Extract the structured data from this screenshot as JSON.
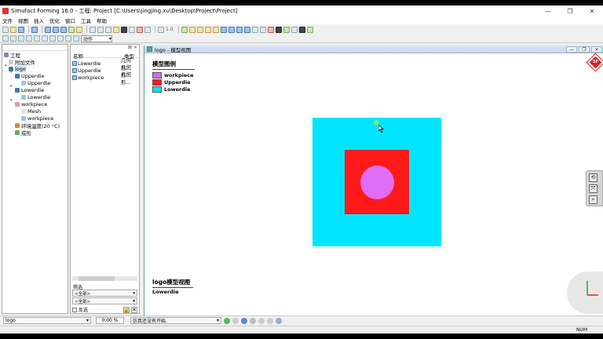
{
  "window": {
    "title": "Simufact Forming 16.0 - 工程: Project [C:\\Users\\jingjing.xu\\Desktop\\Project\\Project]",
    "minimize": "—",
    "maximize": "❐",
    "close": "✕"
  },
  "menu": [
    "文件",
    "视图",
    "插入",
    "优化",
    "窗口",
    "工具",
    "帮助"
  ],
  "toolbar": {
    "zoom_value": "1.0",
    "action_combo": "动作"
  },
  "tree": {
    "items": [
      {
        "label": "工程"
      },
      {
        "label": "附加文件"
      },
      {
        "label": "logo"
      },
      {
        "label": "Upperdie"
      },
      {
        "label": "Upperdie"
      },
      {
        "label": "Lowerdie"
      },
      {
        "label": "Lowerdie"
      },
      {
        "label": "workpiece"
      },
      {
        "label": "Mesh"
      },
      {
        "label": "workpiece"
      },
      {
        "label": "环境温度(20 °C)"
      },
      {
        "label": "成形"
      }
    ]
  },
  "objects": {
    "columns": {
      "name": "名称",
      "type": "类型"
    },
    "rows": [
      {
        "name": "Lowerdie",
        "type": "几何形..."
      },
      {
        "name": "Upperdie",
        "type": "几何形..."
      },
      {
        "name": "workpiece",
        "type": "几何形..."
      }
    ],
    "filter_label": "筛选",
    "filter1": "<全部>",
    "filter2": "<全部>",
    "filter_check": "反选"
  },
  "viewport": {
    "title": "logo - 模型视图",
    "legend_title": "模型图例",
    "legend": [
      {
        "label": "workpiece",
        "color": "#d966f2"
      },
      {
        "label": "Upperdie",
        "color": "#ff1a1a"
      },
      {
        "label": "Lowerdie",
        "color": "#00e5ff"
      }
    ],
    "footer_title": "logo模型视图",
    "footer_sub": "Lowerdie",
    "badge": "SF"
  },
  "bottom": {
    "process": "logo",
    "percent": "0.00 %",
    "status": "仿真还没有开始."
  },
  "statusbar": {
    "num": "NUM"
  },
  "colors": {
    "workpiece": "#df6ef5",
    "upperdie": "#ff1a1a",
    "lowerdie": "#00e5ff"
  }
}
